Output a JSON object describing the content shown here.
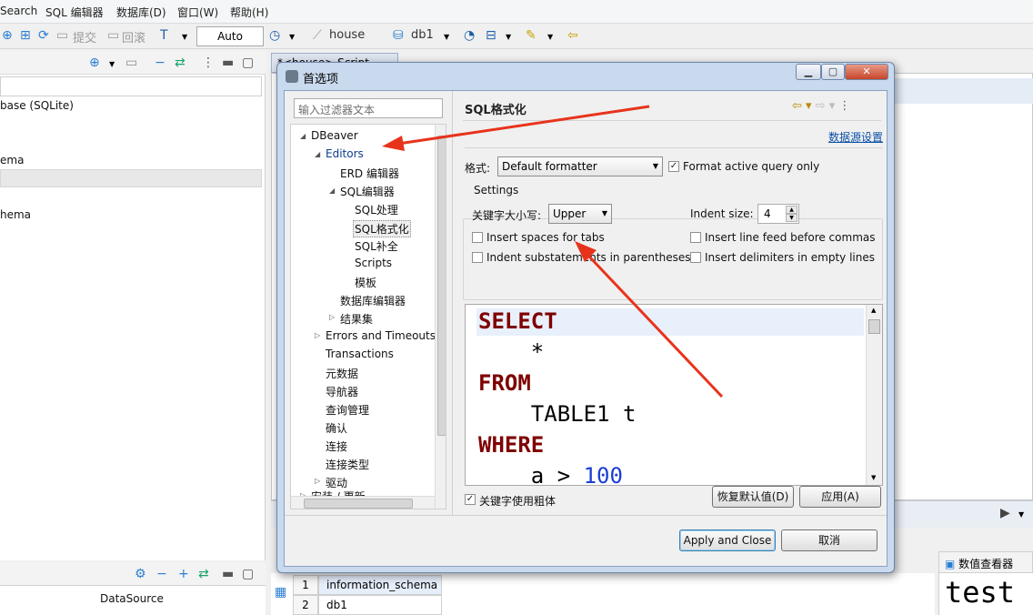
{
  "menu": [
    "Search",
    "SQL 编辑器",
    "数据库(D)",
    "窗口(W)",
    "帮助(H)"
  ],
  "toolbar": {
    "commit": "提交",
    "rollback": "回滚",
    "mode": "Auto",
    "connection": "house",
    "database": "db1"
  },
  "left_panel": {
    "items": [
      "base (SQLite)",
      "ema",
      "hema"
    ],
    "bottom_column": "DataSource"
  },
  "editor": {
    "tab_label": "*<house> Script"
  },
  "results": {
    "rows": [
      {
        "num": "1",
        "value": "information_schema"
      },
      {
        "num": "2",
        "value": "db1"
      }
    ]
  },
  "value_viewer": {
    "title": "数值查看器",
    "value": "test"
  },
  "dialog": {
    "title": "首选项",
    "filter_placeholder": "输入过滤器文本",
    "tree": [
      {
        "label": "DBeaver",
        "level": 0,
        "expanded": true
      },
      {
        "label": "Editors",
        "level": 1,
        "expanded": true
      },
      {
        "label": "ERD 编辑器",
        "level": 2
      },
      {
        "label": "SQL编辑器",
        "level": 2,
        "expanded": true
      },
      {
        "label": "SQL处理",
        "level": 3
      },
      {
        "label": "SQL格式化",
        "level": 3,
        "selected": true
      },
      {
        "label": "SQL补全",
        "level": 3
      },
      {
        "label": "Scripts",
        "level": 3
      },
      {
        "label": "模板",
        "level": 3
      },
      {
        "label": "数据库编辑器",
        "level": 2
      },
      {
        "label": "结果集",
        "level": 2,
        "collapsed": true
      },
      {
        "label": "Errors and Timeouts",
        "level": 1,
        "collapsed": true
      },
      {
        "label": "Transactions",
        "level": 1
      },
      {
        "label": "元数据",
        "level": 1
      },
      {
        "label": "导航器",
        "level": 1
      },
      {
        "label": "查询管理",
        "level": 1
      },
      {
        "label": "确认",
        "level": 1
      },
      {
        "label": "连接",
        "level": 1
      },
      {
        "label": "连接类型",
        "level": 1
      },
      {
        "label": "驱动",
        "level": 1,
        "collapsed": true
      },
      {
        "label": "安装 / 更新",
        "level": 0,
        "collapsed": true
      }
    ],
    "page_title": "SQL格式化",
    "datasource_link": "数据源设置",
    "format_label": "格式:",
    "formatter": "Default formatter",
    "format_active_only": "Format active query only",
    "settings_label": "Settings",
    "keyword_case_label": "关键字大小写:",
    "keyword_case": "Upper",
    "indent_size_label": "Indent size:",
    "indent_size": "4",
    "options": {
      "insert_spaces": "Insert spaces for tabs",
      "line_feed": "Insert line feed before commas",
      "indent_sub": "Indent substatements in parentheses",
      "delimiters": "Insert delimiters in empty lines"
    },
    "preview": {
      "kw1": "SELECT",
      "l2": "    *",
      "kw2": "FROM",
      "l4": "    TABLE1 t",
      "kw3": "WHERE",
      "l6a": "    a > ",
      "l6b": "100"
    },
    "bold_keywords": "关键字使用粗体",
    "restore_defaults": "恢复默认值(D)",
    "apply": "应用(A)",
    "apply_close": "Apply and Close",
    "cancel": "取消"
  },
  "colors": {
    "keyword": "#7f0000",
    "number": "#1b3dd6",
    "arrow": "#e8331c"
  }
}
